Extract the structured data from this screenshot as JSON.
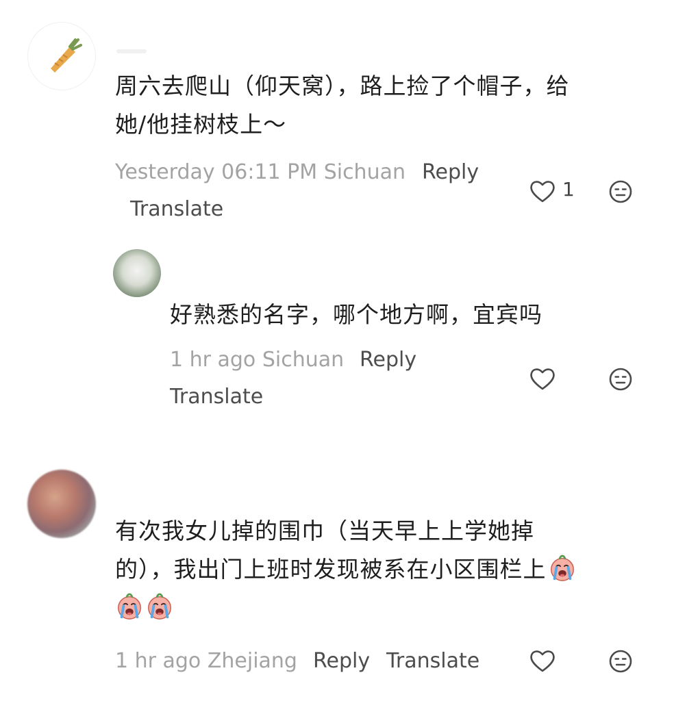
{
  "comments": [
    {
      "text_line1": "周六去爬山（仰天窝），路上捡了个帽子，给",
      "text_line2": "她/他挂树枝上～",
      "time": "Yesterday 06:11 PM",
      "location": "Sichuan",
      "reply_label": "Reply",
      "translate_label": "Translate",
      "like_count": "1"
    },
    {
      "text_line1": "好熟悉的名字，哪个地方啊，宜宾吗",
      "time": "1 hr ago",
      "location": "Sichuan",
      "reply_label": "Reply",
      "translate_label": "Translate",
      "like_count": ""
    },
    {
      "text_line1": "有次我女儿掉的围巾（当天早上上学她掉",
      "text_line2": "的），我出门上班时发现被系在小区围栏上",
      "time": "1 hr ago",
      "location": "Zhejiang",
      "reply_label": "Reply",
      "translate_label": "Translate",
      "like_count": ""
    }
  ],
  "icons": {
    "like": "heart-outline-icon",
    "dislike": "neutral-face-icon",
    "emoji": "crying-face-emoji"
  },
  "colors": {
    "meta_gray": "#a3a3a3",
    "action_gray": "#4d4d4d",
    "text": "#1e1e1e",
    "emoji_pink": "#f6a9a0"
  }
}
